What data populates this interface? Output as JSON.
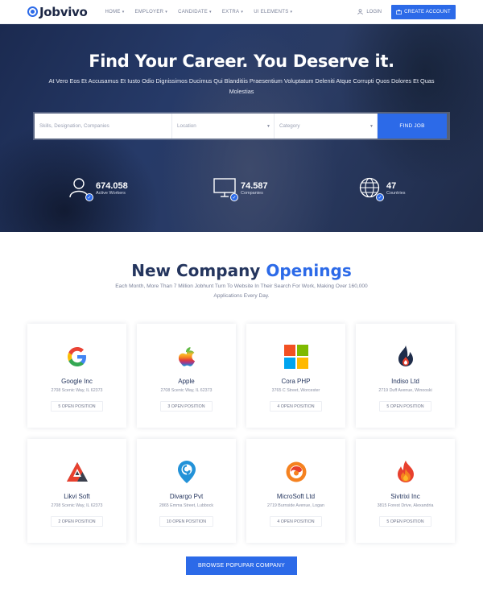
{
  "nav": {
    "logo": "Jobvivo",
    "menu": [
      {
        "label": "HOME"
      },
      {
        "label": "EMPLOYER"
      },
      {
        "label": "CANDIDATE"
      },
      {
        "label": "EXTRA"
      },
      {
        "label": "UI ELEMENTS"
      }
    ],
    "login": "LOGIN",
    "create_account": "CREATE ACCOUNT"
  },
  "hero": {
    "title": "Find Your Career. You Deserve it.",
    "subtitle": "At Vero Eos Et Accusamus Et Iusto Odio Dignissimos Ducimus Qui Blanditiis Praesentium Voluptatum Deleniti Atque Corrupti Quos Dolores Et Quas Molestias",
    "search": {
      "keyword_placeholder": "Skills, Designation, Companies",
      "location": "Location",
      "category": "Category",
      "button": "FIND JOB"
    },
    "stats": [
      {
        "number": "674.058",
        "label": "Active Workers",
        "icon": "user-icon"
      },
      {
        "number": "74.587",
        "label": "Companies",
        "icon": "monitor-icon"
      },
      {
        "number": "47",
        "label": "Countries",
        "icon": "globe-icon"
      }
    ]
  },
  "section": {
    "title_main": "New Company",
    "title_accent": "Openings",
    "subtitle": "Each Month, More Than 7 Million Jobhunt Turn To Website In Their Search For Work, Making Over 160,000 Applications Every Day.",
    "companies": [
      {
        "name": "Google Inc",
        "address": "2708 Scenic Way, IL 62373",
        "positions": "5 OPEN POSITION",
        "logo": "google-logo"
      },
      {
        "name": "Apple",
        "address": "2708 Scenic Way, IL 62373",
        "positions": "3 OPEN POSITION",
        "logo": "apple-logo"
      },
      {
        "name": "Cora PHP",
        "address": "3765 C Street, Worcester",
        "positions": "4 OPEN POSITION",
        "logo": "cora-logo"
      },
      {
        "name": "Indiso Ltd",
        "address": "2719 Duff Avenue, Winooski",
        "positions": "5 OPEN POSITION",
        "logo": "indiso-logo"
      },
      {
        "name": "Likvi Soft",
        "address": "2708 Scenic Way, IL 62373",
        "positions": "2 OPEN POSITION",
        "logo": "likvi-logo"
      },
      {
        "name": "Divargo Pvt",
        "address": "2865 Emma Street, Lubbock",
        "positions": "10 OPEN POSITION",
        "logo": "divargo-logo"
      },
      {
        "name": "MicroSoft Ltd",
        "address": "2719 Burnside Avenue, Logan",
        "positions": "4 OPEN POSITION",
        "logo": "microsoft-logo"
      },
      {
        "name": "Sivtrixi Inc",
        "address": "3815 Forest Drive, Alexandria",
        "positions": "5 OPEN POSITION",
        "logo": "sivtrixi-logo"
      }
    ],
    "browse_button": "BROWSE POPUPAR COMPANY"
  },
  "colors": {
    "accent": "#2c6ae8",
    "dark": "#24355e"
  }
}
